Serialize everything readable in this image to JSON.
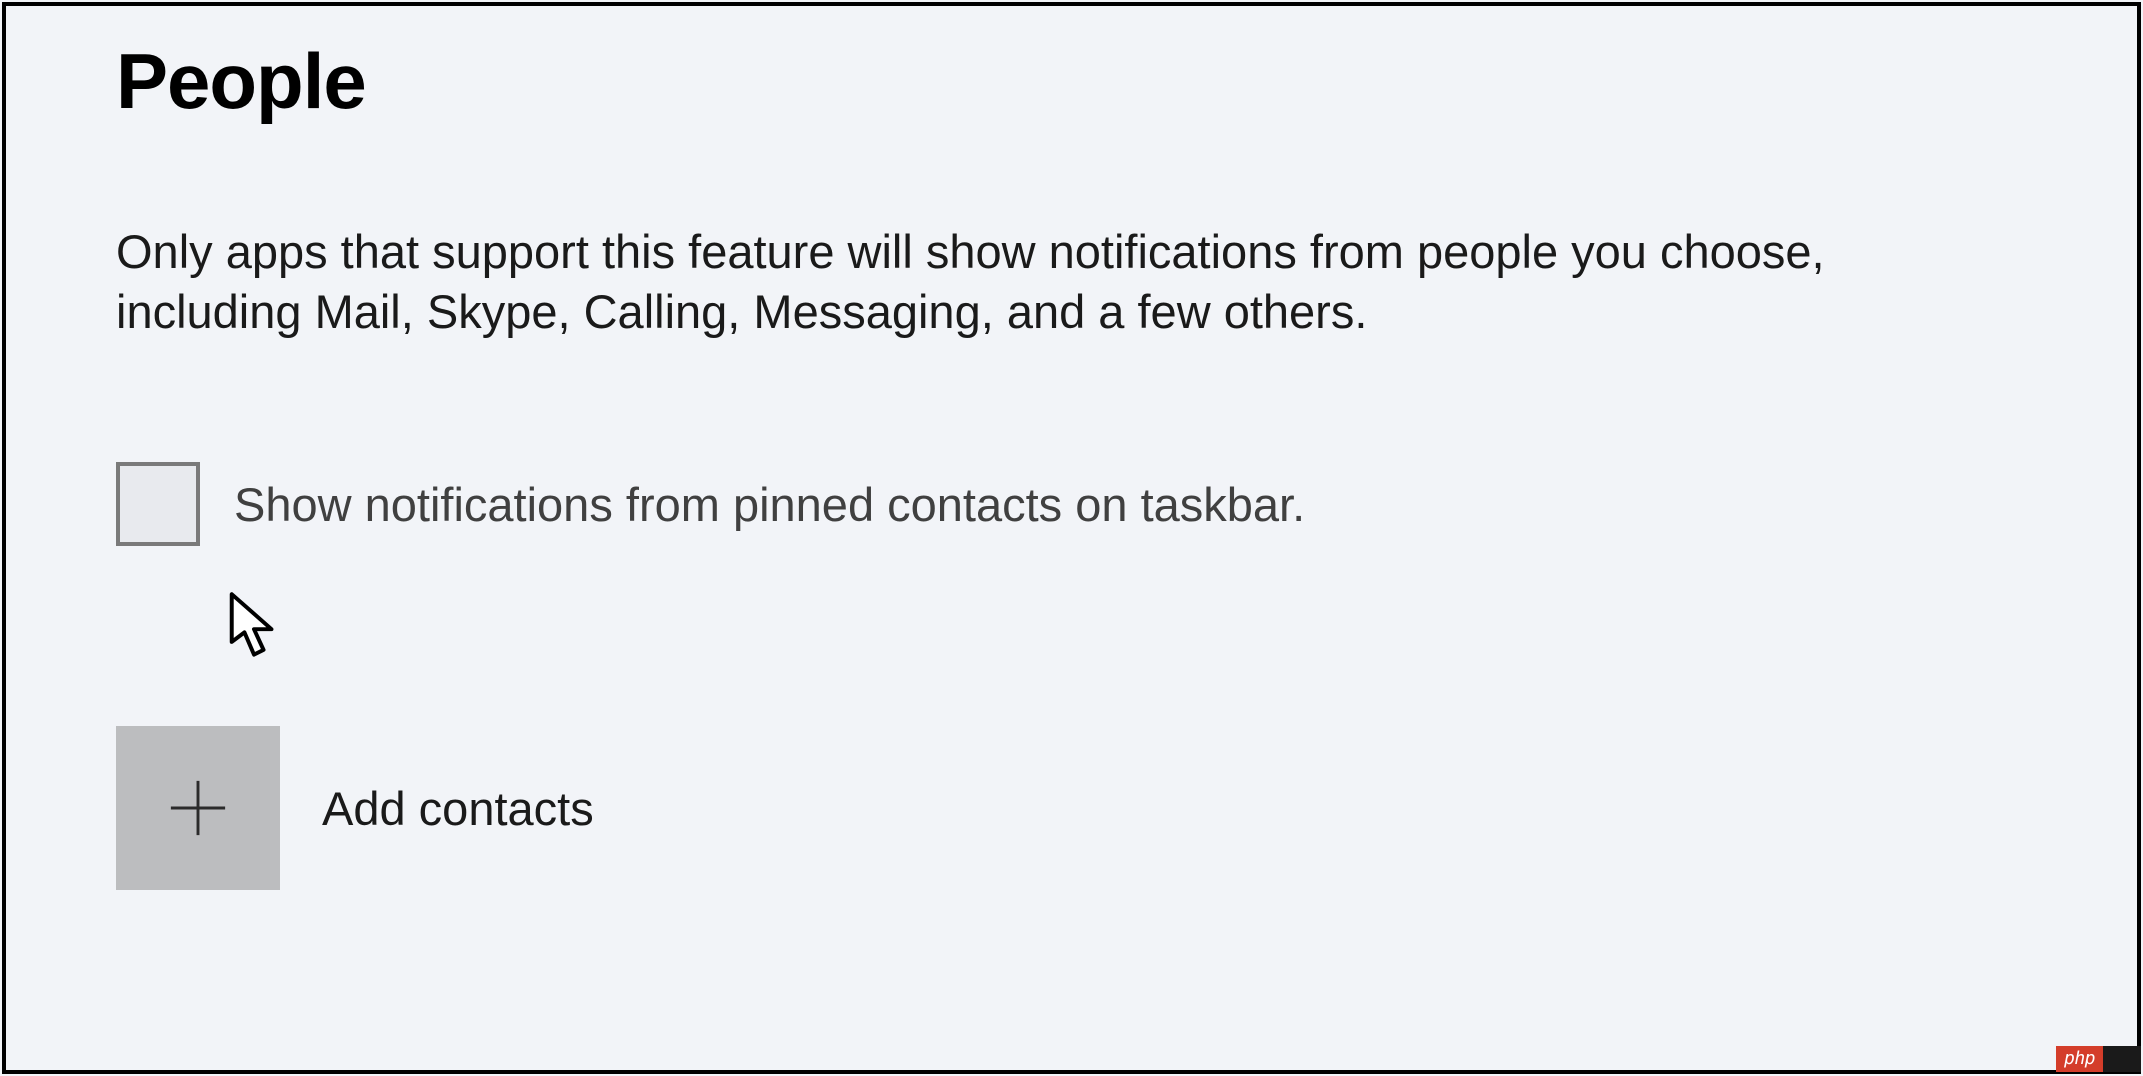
{
  "heading": "People",
  "description": "Only apps that support this feature will show notifications from people you choose, including Mail, Skype, Calling, Messaging, and a few others.",
  "checkbox": {
    "checked": false,
    "label": "Show notifications from pinned contacts on taskbar."
  },
  "addContacts": {
    "label": "Add contacts"
  },
  "badge": {
    "left": "php"
  }
}
